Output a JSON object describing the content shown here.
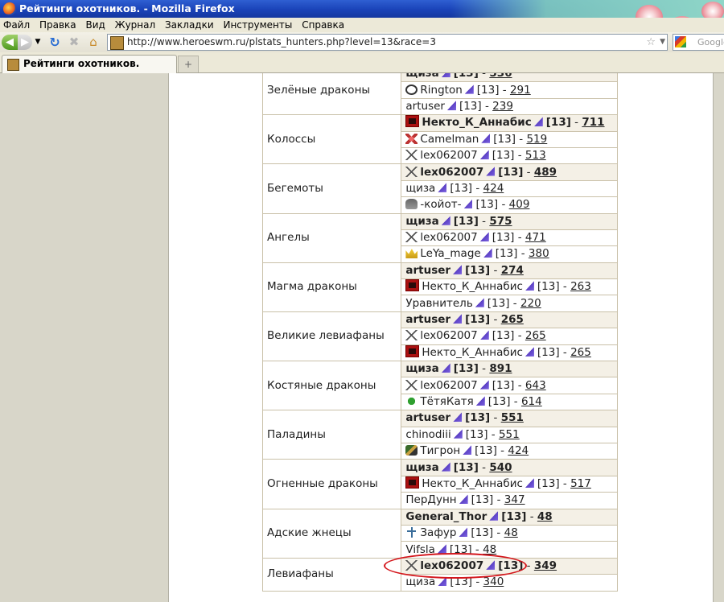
{
  "window": {
    "title": "Рейтинги охотников. - Mozilla Firefox"
  },
  "menu": [
    "Файл",
    "Правка",
    "Вид",
    "Журнал",
    "Закладки",
    "Инструменты",
    "Справка"
  ],
  "nav": {
    "url": "http://www.heroeswm.ru/plstats_hunters.php?level=13&race=3",
    "search_placeholder": "Google"
  },
  "tabs": {
    "active": "Рейтинги охотников.",
    "new_tab": "+"
  },
  "rating_rows": [
    {
      "creature": "Зелёные драконы",
      "entries": [
        {
          "icon": "none",
          "name": "щиза",
          "level": "[13]",
          "score": "536",
          "top": true
        },
        {
          "icon": "swirl",
          "name": "Rington",
          "level": "[13]",
          "score": "291",
          "top": false
        },
        {
          "icon": "none",
          "name": "artuser",
          "level": "[13]",
          "score": "239",
          "top": false
        }
      ]
    },
    {
      "creature": "Колоссы",
      "entries": [
        {
          "icon": "clan",
          "name": "Некто_К_Аннабис",
          "level": "[13]",
          "score": "711",
          "top": true
        },
        {
          "icon": "diamond",
          "name": "Camelman",
          "level": "[13]",
          "score": "519",
          "top": false
        },
        {
          "icon": "cross",
          "name": "lex062007",
          "level": "[13]",
          "score": "513",
          "top": false
        }
      ]
    },
    {
      "creature": "Бегемоты",
      "entries": [
        {
          "icon": "cross",
          "name": "lex062007",
          "level": "[13]",
          "score": "489",
          "top": true
        },
        {
          "icon": "none",
          "name": "щиза",
          "level": "[13]",
          "score": "424",
          "top": false
        },
        {
          "icon": "coyote",
          "name": "-койот-",
          "level": "[13]",
          "score": "409",
          "top": false
        }
      ]
    },
    {
      "creature": "Ангелы",
      "entries": [
        {
          "icon": "none",
          "name": "щиза",
          "level": "[13]",
          "score": "575",
          "top": true
        },
        {
          "icon": "cross",
          "name": "lex062007",
          "level": "[13]",
          "score": "471",
          "top": false
        },
        {
          "icon": "crown",
          "name": "LeYa_mage",
          "level": "[13]",
          "score": "380",
          "top": false
        }
      ]
    },
    {
      "creature": "Магма драконы",
      "entries": [
        {
          "icon": "none",
          "name": "artuser",
          "level": "[13]",
          "score": "274",
          "top": true
        },
        {
          "icon": "clan",
          "name": "Некто_К_Аннабис",
          "level": "[13]",
          "score": "263",
          "top": false
        },
        {
          "icon": "none",
          "name": "Уравнитель",
          "level": "[13]",
          "score": "220",
          "top": false
        }
      ]
    },
    {
      "creature": "Великие левиафаны",
      "entries": [
        {
          "icon": "none",
          "name": "artuser",
          "level": "[13]",
          "score": "265",
          "top": true
        },
        {
          "icon": "cross",
          "name": "lex062007",
          "level": "[13]",
          "score": "265",
          "top": false
        },
        {
          "icon": "clan",
          "name": "Некто_К_Аннабис",
          "level": "[13]",
          "score": "265",
          "top": false
        }
      ]
    },
    {
      "creature": "Костяные драконы",
      "entries": [
        {
          "icon": "none",
          "name": "щиза",
          "level": "[13]",
          "score": "891",
          "top": true
        },
        {
          "icon": "cross",
          "name": "lex062007",
          "level": "[13]",
          "score": "643",
          "top": false
        },
        {
          "icon": "clover",
          "name": "ТётяКатя",
          "level": "[13]",
          "score": "614",
          "top": false
        }
      ]
    },
    {
      "creature": "Паладины",
      "entries": [
        {
          "icon": "none",
          "name": "artuser",
          "level": "[13]",
          "score": "551",
          "top": true
        },
        {
          "icon": "none",
          "name": "chinodiii",
          "level": "[13]",
          "score": "551",
          "top": false
        },
        {
          "icon": "tiger",
          "name": "Тигрон",
          "level": "[13]",
          "score": "424",
          "top": false
        }
      ]
    },
    {
      "creature": "Огненные драконы",
      "entries": [
        {
          "icon": "none",
          "name": "щиза",
          "level": "[13]",
          "score": "540",
          "top": true
        },
        {
          "icon": "clan",
          "name": "Некто_К_Аннабис",
          "level": "[13]",
          "score": "517",
          "top": false
        },
        {
          "icon": "none",
          "name": "ПерДунн",
          "level": "[13]",
          "score": "347",
          "top": false
        }
      ]
    },
    {
      "creature": "Адские жнецы",
      "entries": [
        {
          "icon": "none",
          "name": "General_Thor",
          "level": "[13]",
          "score": "48",
          "top": true
        },
        {
          "icon": "trident",
          "name": "Зафур",
          "level": "[13]",
          "score": "48",
          "top": false
        },
        {
          "icon": "none",
          "name": "Vifsla",
          "level": "[13]",
          "score": "48",
          "top": false
        }
      ]
    },
    {
      "creature": "Левиафаны",
      "entries": [
        {
          "icon": "cross",
          "name": "lex062007",
          "level": "[13]",
          "score": "349",
          "top": true
        },
        {
          "icon": "none",
          "name": "щиза",
          "level": "[13]",
          "score": "340",
          "top": false
        }
      ]
    }
  ]
}
